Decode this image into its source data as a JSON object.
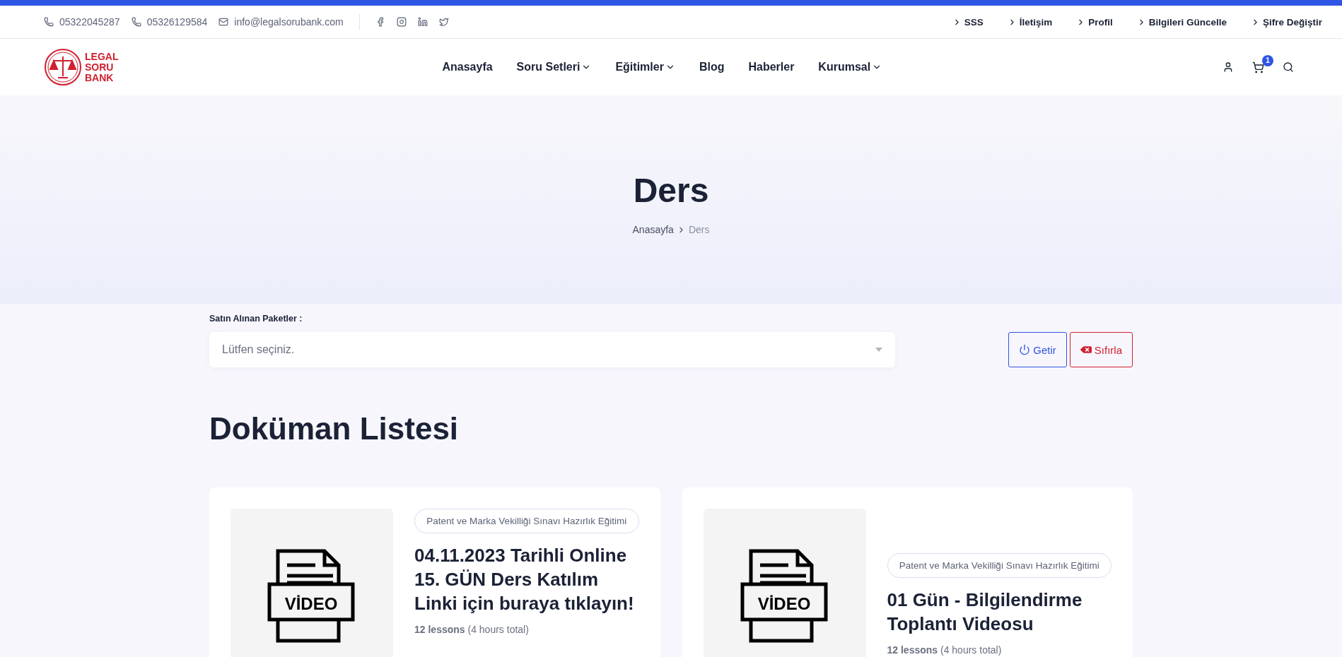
{
  "top_bar": {
    "contacts": [
      {
        "kind": "phone",
        "text": "05322045287"
      },
      {
        "kind": "phone",
        "text": "05326129584"
      },
      {
        "kind": "email",
        "text": "info@legalsorubank.com"
      }
    ],
    "socials": [
      {
        "kind": "facebook"
      },
      {
        "kind": "instagram"
      },
      {
        "kind": "linkedin"
      },
      {
        "kind": "twitter"
      }
    ],
    "links": [
      "SSS",
      "İletişim",
      "Profil",
      "Bilgileri Güncelle",
      "Şifre Değiştir"
    ]
  },
  "header": {
    "logo_lines": [
      "LEGAL",
      "SORU",
      "BANK"
    ],
    "nav": [
      {
        "label": "Anasayfa",
        "has_menu": false
      },
      {
        "label": "Soru Setleri",
        "has_menu": true
      },
      {
        "label": "Eğitimler",
        "has_menu": true
      },
      {
        "label": "Blog",
        "has_menu": false
      },
      {
        "label": "Haberler",
        "has_menu": false
      },
      {
        "label": "Kurumsal",
        "has_menu": true
      }
    ],
    "cart_count": "1"
  },
  "hero": {
    "title": "Ders",
    "breadcrumb": [
      "Anasayfa",
      "Ders"
    ]
  },
  "filter": {
    "label": "Satın Alınan Paketler :",
    "placeholder": "Lütfen seçiniz.",
    "buttons": [
      {
        "kind": "fetch",
        "label": "Getir"
      },
      {
        "kind": "reset",
        "label": "Sıfırla"
      }
    ]
  },
  "section_title": "Doküman Listesi",
  "cards": [
    {
      "thumb_label": "VİDEO",
      "category": "Patent ve Marka Vekilliği Sınavı Hazırlık Eğitimi",
      "title": "04.11.2023 Tarihli Online 15. GÜN Ders Katılım Linki için buraya tıklayın!",
      "lessons": "12 lessons",
      "duration": "(4 hours total)"
    },
    {
      "thumb_label": "VİDEO",
      "category": "Patent ve Marka Vekilliği Sınavı Hazırlık Eğitimi",
      "title": "01 Gün - Bilgilendirme Toplantı Videosu",
      "lessons": "12 lessons",
      "duration": "(4 hours total)"
    }
  ]
}
